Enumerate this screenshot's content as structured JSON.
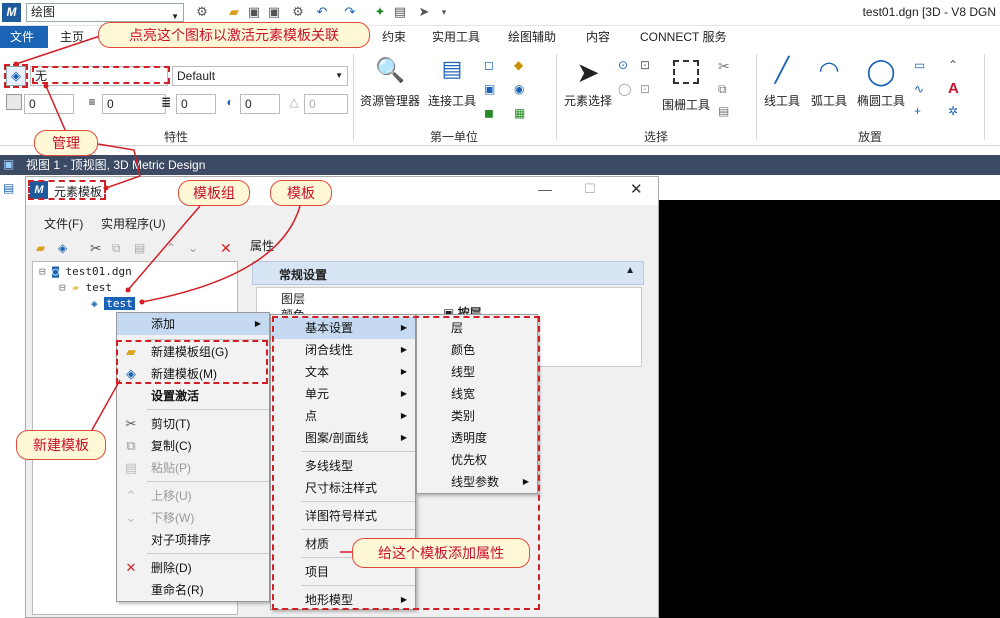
{
  "qat": {
    "workspace": "绘图",
    "window_title": "test01.dgn [3D - V8 DGN"
  },
  "tabs": [
    "文件",
    "主页",
    "约束",
    "实用工具",
    "绘图辅助",
    "内容",
    "CONNECT 服务"
  ],
  "ribbon": {
    "level_value": "无",
    "style_value": "Default",
    "counters": [
      "0",
      "0",
      "0",
      "0",
      "0"
    ],
    "groups": {
      "properties": "特性",
      "primary": "第一单位",
      "selection": "选择",
      "placement": "放置"
    },
    "buttons": {
      "resource_manager": "资源管理器",
      "connect_tools": "连接工具",
      "element_select": "元素选择",
      "fence": "围栅工具",
      "line": "线工具",
      "arc": "弧工具",
      "ellipse": "椭圆工具"
    }
  },
  "view_title": "视图 1 - 顶视图, 3D Metric Design",
  "dialog": {
    "title": "元素模板",
    "menus": [
      "文件(F)",
      "实用程序(U)"
    ],
    "tree": [
      "test01.dgn",
      "test",
      "test"
    ],
    "props_label": "属性",
    "section": "常规设置",
    "prop_rows": [
      "图层",
      "颜色"
    ],
    "prop_value": "按层"
  },
  "context_menu": {
    "add": "添加",
    "new_group": "新建模板组(G)",
    "new_template": "新建模板(M)",
    "set_active": "设置激活",
    "cut": "剪切(T)",
    "copy": "复制(C)",
    "paste": "粘贴(P)",
    "move_up": "上移(U)",
    "move_down": "下移(W)",
    "sort": "对子项排序",
    "delete": "删除(D)",
    "rename": "重命名(R)"
  },
  "submenu1": [
    "基本设置",
    "闭合线性",
    "文本",
    "单元",
    "点",
    "图案/剖面线",
    "多线线型",
    "尺寸标注样式",
    "详图符号样式",
    "材质",
    "项目",
    "地形模型"
  ],
  "submenu2": [
    "层",
    "颜色",
    "线型",
    "线宽",
    "类别",
    "透明度",
    "优先权",
    "线型参数"
  ],
  "callouts": {
    "activate": "点亮这个图标以激活元素模板关联",
    "manage": "管理",
    "group": "模板组",
    "template": "模板",
    "new_template": "新建模板",
    "add_props": "给这个模板添加属性"
  },
  "colors": {
    "accent": "#1b63b5",
    "callout_border": "#e04a3a",
    "callout_text": "#c8102e",
    "dash": "#d21f26"
  }
}
